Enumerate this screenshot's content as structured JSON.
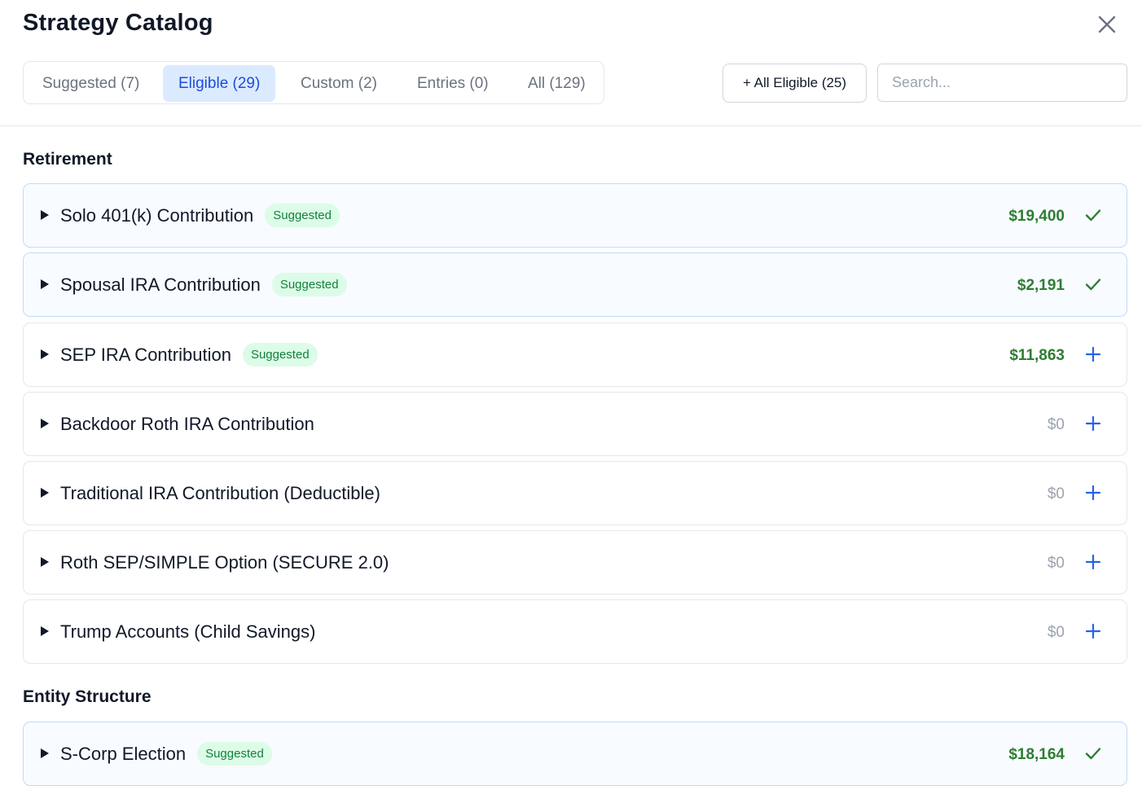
{
  "title": "Strategy Catalog",
  "tabs": [
    {
      "label": "Suggested (7)",
      "active": false
    },
    {
      "label": "Eligible (29)",
      "active": true
    },
    {
      "label": "Custom (2)",
      "active": false
    },
    {
      "label": "Entries (0)",
      "active": false
    },
    {
      "label": "All (129)",
      "active": false
    }
  ],
  "toolbar": {
    "all_eligible_label": "+ All Eligible (25)"
  },
  "search": {
    "placeholder": "Search...",
    "value": ""
  },
  "sections": [
    {
      "title": "Retirement",
      "items": [
        {
          "name": "Solo 401(k) Contribution",
          "badge": "Suggested",
          "amount": "$19,400",
          "status": "added",
          "action_icon": "check-icon"
        },
        {
          "name": "Spousal IRA Contribution",
          "badge": "Suggested",
          "amount": "$2,191",
          "status": "added",
          "action_icon": "check-icon"
        },
        {
          "name": "SEP IRA Contribution",
          "badge": "Suggested",
          "amount": "$11,863",
          "status": "available",
          "action_icon": "plus-icon"
        },
        {
          "name": "Backdoor Roth IRA Contribution",
          "badge": "",
          "amount": "$0",
          "status": "available",
          "action_icon": "plus-icon"
        },
        {
          "name": "Traditional IRA Contribution (Deductible)",
          "badge": "",
          "amount": "$0",
          "status": "available",
          "action_icon": "plus-icon"
        },
        {
          "name": "Roth SEP/SIMPLE Option (SECURE 2.0)",
          "badge": "",
          "amount": "$0",
          "status": "available",
          "action_icon": "plus-icon"
        },
        {
          "name": "Trump Accounts (Child Savings)",
          "badge": "",
          "amount": "$0",
          "status": "available",
          "action_icon": "plus-icon"
        }
      ]
    },
    {
      "title": "Entity Structure",
      "items": [
        {
          "name": "S-Corp Election",
          "badge": "Suggested",
          "amount": "$18,164",
          "status": "added",
          "action_icon": "check-icon"
        }
      ]
    }
  ],
  "colors": {
    "accent": "#1d4ed8",
    "accent_bg": "#dbeafe",
    "positive": "#2e7d32",
    "badge_bg": "#dcfce7",
    "badge_text": "#15803d",
    "muted": "#9ca3af",
    "plus": "#2563eb"
  }
}
